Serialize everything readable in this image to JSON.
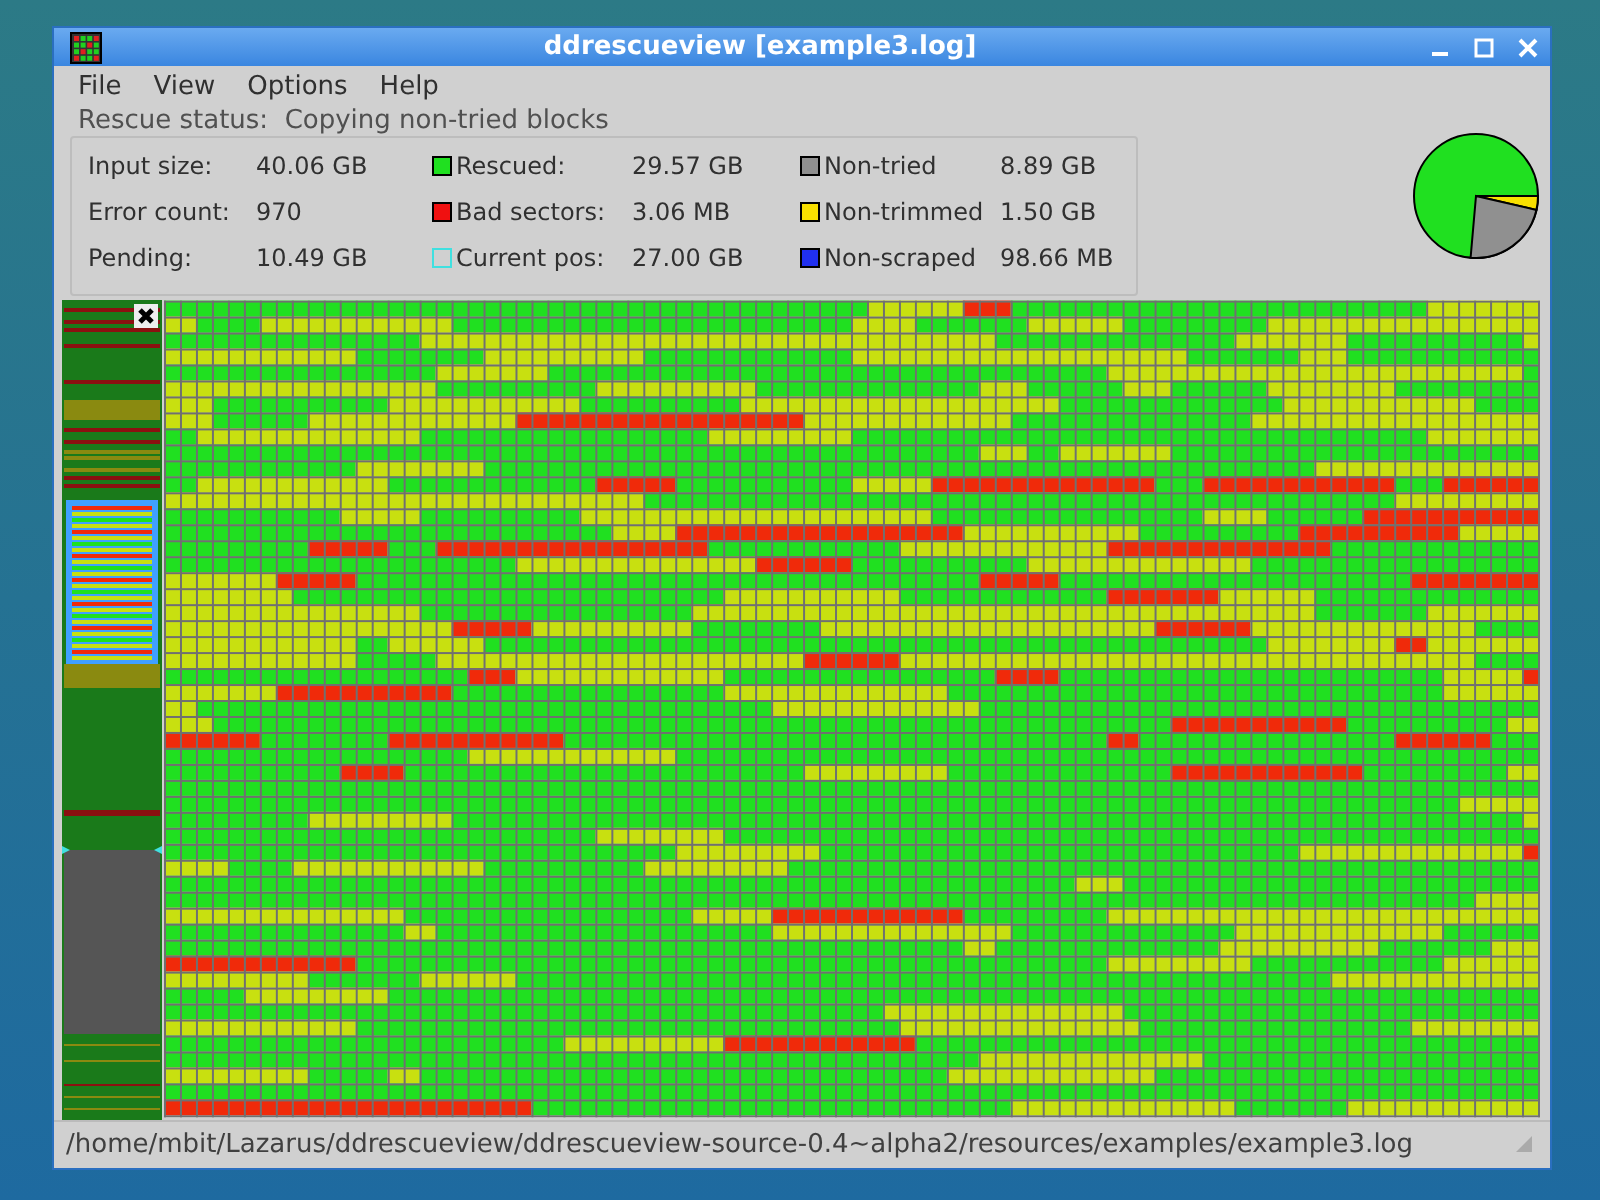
{
  "window": {
    "title": "ddrescueview [example3.log]"
  },
  "menu": [
    "File",
    "View",
    "Options",
    "Help"
  ],
  "rescue_status": {
    "label": "Rescue status:",
    "value": "Copying non-tried blocks"
  },
  "stat_columns": [
    {
      "items": [
        {
          "kind": "plain",
          "label": "Input size:",
          "value": "40.06 GB"
        },
        {
          "kind": "plain",
          "label": "Error count:",
          "value": "970"
        },
        {
          "kind": "plain",
          "label": "Pending:",
          "value": "10.49 GB"
        }
      ]
    },
    {
      "items": [
        {
          "kind": "swatch",
          "color": "#20e020",
          "label": "Rescued:",
          "value": "29.57 GB"
        },
        {
          "kind": "swatch",
          "color": "#f01010",
          "label": "Bad sectors:",
          "value": "3.06 MB"
        },
        {
          "kind": "outline",
          "color": "#40e0e0",
          "label": "Current pos:",
          "value": "27.00 GB"
        }
      ]
    },
    {
      "items": [
        {
          "kind": "swatch",
          "color": "#909090",
          "label": "Non-tried",
          "value": "8.89 GB"
        },
        {
          "kind": "swatch",
          "color": "#f8e000",
          "label": "Non-trimmed",
          "value": "1.50 GB"
        },
        {
          "kind": "swatch",
          "color": "#2030f0",
          "label": "Non-scraped",
          "value": "98.66 MB"
        }
      ]
    }
  ],
  "status_bar": {
    "path": "/home/mbit/Lazarus/ddrescueview/ddrescueview-source-0.4~alpha2/resources/examples/example3.log"
  }
}
